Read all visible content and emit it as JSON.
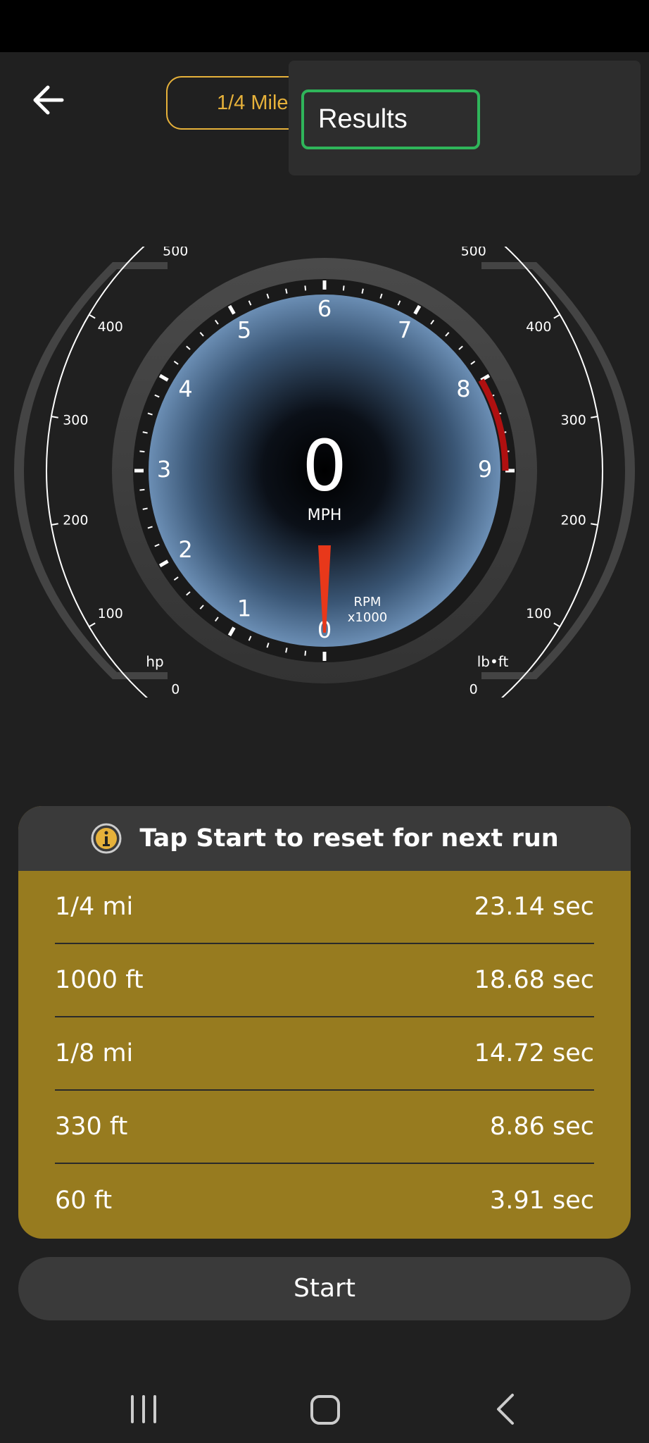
{
  "header": {
    "mode_label": "1/4 Mile",
    "menu_item": "Results"
  },
  "gauge": {
    "speed_value": "0",
    "speed_unit": "MPH",
    "rpm_label": "RPM",
    "rpm_multiplier": "x1000",
    "rpm_ticks": [
      "0",
      "1",
      "2",
      "3",
      "4",
      "5",
      "6",
      "7",
      "8",
      "9"
    ],
    "hp_unit": "hp",
    "torque_unit": "lb•ft",
    "hp_ticks": [
      "0",
      "100",
      "200",
      "300",
      "400",
      "500"
    ],
    "torque_ticks": [
      "0",
      "100",
      "200",
      "300",
      "400",
      "500"
    ],
    "redline_color": "#b01010",
    "needle_color": "#e8381a"
  },
  "results": {
    "header_text": "Tap Start to reset for next run",
    "rows": [
      {
        "distance": "1/4 mi",
        "time": "23.14 sec"
      },
      {
        "distance": "1000 ft",
        "time": "18.68 sec"
      },
      {
        "distance": "1/8 mi",
        "time": "14.72 sec"
      },
      {
        "distance": "330 ft",
        "time": "8.86 sec"
      },
      {
        "distance": "60 ft",
        "time": "3.91 sec"
      }
    ]
  },
  "start_label": "Start",
  "icons": {
    "back": "arrow-left-icon",
    "info": "info-icon",
    "recents": "recents-icon",
    "home": "home-icon",
    "nav_back": "chevron-left-icon"
  },
  "colors": {
    "accent": "#e6b13a",
    "results_bg": "#977b1f",
    "selection": "#2fb55a"
  }
}
